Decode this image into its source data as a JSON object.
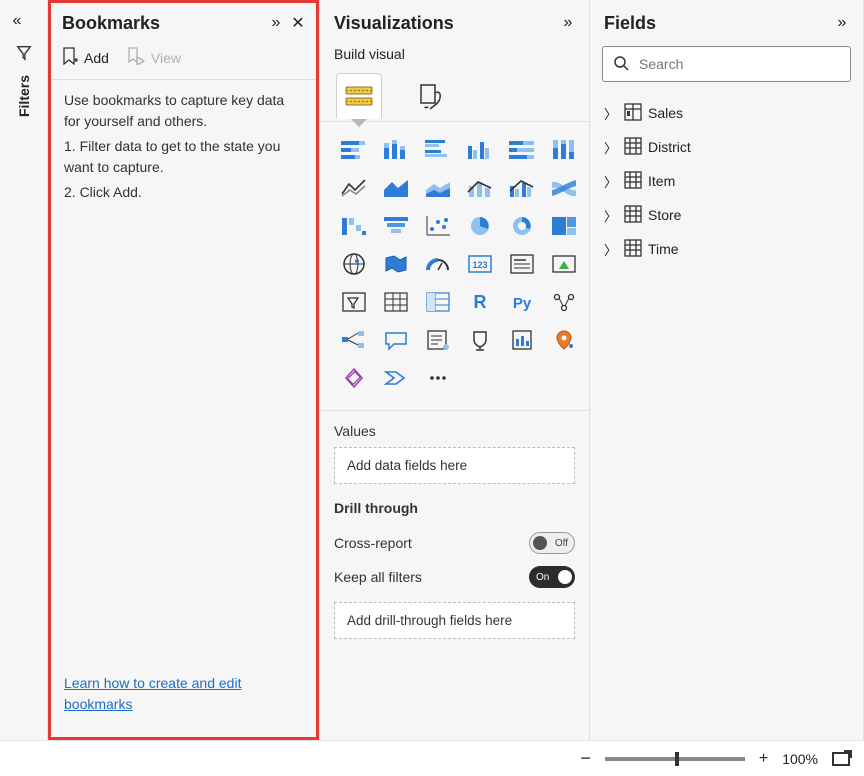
{
  "filters_rail": {
    "label": "Filters"
  },
  "bookmarks": {
    "title": "Bookmarks",
    "add_label": "Add",
    "view_label": "View",
    "intro": "Use bookmarks to capture key data for yourself and others.",
    "step1": "1. Filter data to get to the state you want to capture.",
    "step2": "2. Click Add.",
    "learn_link": "Learn how to create and edit bookmarks"
  },
  "viz": {
    "title": "Visualizations",
    "subtitle": "Build visual",
    "values_label": "Values",
    "values_placeholder": "Add data fields here",
    "drill_title": "Drill through",
    "cross_report_label": "Cross-report",
    "cross_report_state": "Off",
    "keep_filters_label": "Keep all filters",
    "keep_filters_state": "On",
    "drill_placeholder": "Add drill-through fields here"
  },
  "fields": {
    "title": "Fields",
    "search_placeholder": "Search",
    "tables": [
      {
        "name": "Sales",
        "icon": "db"
      },
      {
        "name": "District",
        "icon": "tbl"
      },
      {
        "name": "Item",
        "icon": "tbl"
      },
      {
        "name": "Store",
        "icon": "tbl"
      },
      {
        "name": "Time",
        "icon": "tbl"
      }
    ]
  },
  "zoom": {
    "pct": "100%"
  }
}
